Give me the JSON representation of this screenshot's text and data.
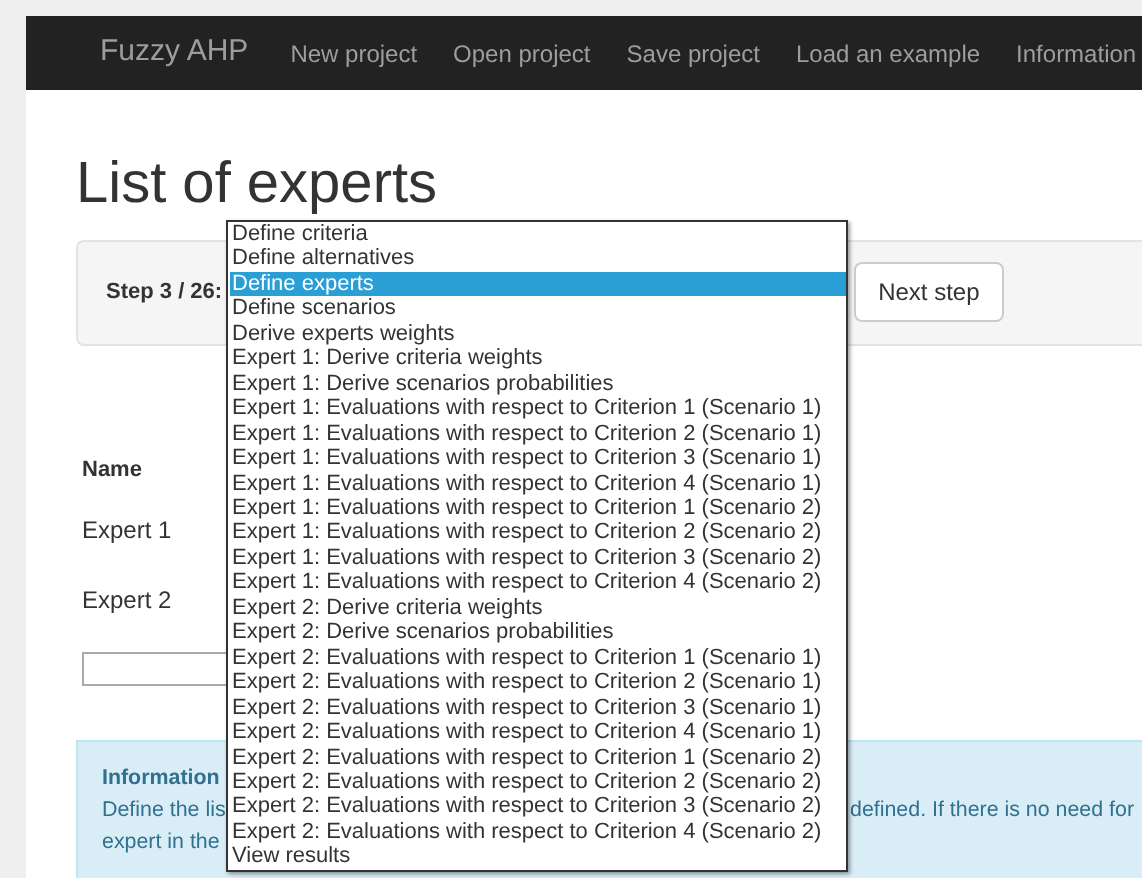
{
  "navbar": {
    "brand": "Fuzzy AHP",
    "items": [
      "New project",
      "Open project",
      "Save project",
      "Load an example",
      "Information"
    ]
  },
  "page_title": "List of experts",
  "step": {
    "label": "Step 3 / 26:",
    "next_button": "Next step"
  },
  "step_dropdown": {
    "options": [
      {
        "label": "Define criteria",
        "selected": false
      },
      {
        "label": "Define alternatives",
        "selected": false
      },
      {
        "label": "Define experts",
        "selected": true
      },
      {
        "label": "Define scenarios",
        "selected": false
      },
      {
        "label": "Derive experts weights",
        "selected": false
      },
      {
        "label": "Expert 1: Derive criteria weights",
        "selected": false
      },
      {
        "label": "Expert 1: Derive scenarios probabilities",
        "selected": false
      },
      {
        "label": "Expert 1: Evaluations with respect to Criterion 1 (Scenario 1)",
        "selected": false
      },
      {
        "label": "Expert 1: Evaluations with respect to Criterion 2 (Scenario 1)",
        "selected": false
      },
      {
        "label": "Expert 1: Evaluations with respect to Criterion 3 (Scenario 1)",
        "selected": false
      },
      {
        "label": "Expert 1: Evaluations with respect to Criterion 4 (Scenario 1)",
        "selected": false
      },
      {
        "label": "Expert 1: Evaluations with respect to Criterion 1 (Scenario 2)",
        "selected": false
      },
      {
        "label": "Expert 1: Evaluations with respect to Criterion 2 (Scenario 2)",
        "selected": false
      },
      {
        "label": "Expert 1: Evaluations with respect to Criterion 3 (Scenario 2)",
        "selected": false
      },
      {
        "label": "Expert 1: Evaluations with respect to Criterion 4 (Scenario 2)",
        "selected": false
      },
      {
        "label": "Expert 2: Derive criteria weights",
        "selected": false
      },
      {
        "label": "Expert 2: Derive scenarios probabilities",
        "selected": false
      },
      {
        "label": "Expert 2: Evaluations with respect to Criterion 1 (Scenario 1)",
        "selected": false
      },
      {
        "label": "Expert 2: Evaluations with respect to Criterion 2 (Scenario 1)",
        "selected": false
      },
      {
        "label": "Expert 2: Evaluations with respect to Criterion 3 (Scenario 1)",
        "selected": false
      },
      {
        "label": "Expert 2: Evaluations with respect to Criterion 4 (Scenario 1)",
        "selected": false
      },
      {
        "label": "Expert 2: Evaluations with respect to Criterion 1 (Scenario 2)",
        "selected": false
      },
      {
        "label": "Expert 2: Evaluations with respect to Criterion 2 (Scenario 2)",
        "selected": false
      },
      {
        "label": "Expert 2: Evaluations with respect to Criterion 3 (Scenario 2)",
        "selected": false
      },
      {
        "label": "Expert 2: Evaluations with respect to Criterion 4 (Scenario 2)",
        "selected": false
      },
      {
        "label": "View results",
        "selected": false
      }
    ]
  },
  "experts_table": {
    "columns": [
      "Name"
    ],
    "rows": [
      "Expert 1",
      "Expert 2"
    ]
  },
  "info": {
    "title": "Information",
    "text_parts": [
      "Define the lis",
      "defined. If there is no need for",
      "expert in the"
    ]
  }
}
